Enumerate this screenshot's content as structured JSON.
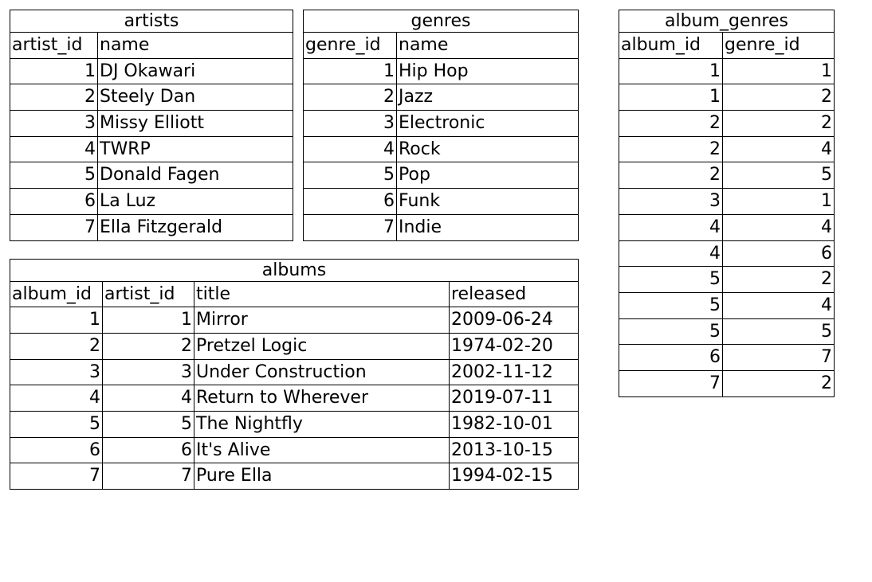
{
  "tables": {
    "artists": {
      "title": "artists",
      "columns": [
        "artist_id",
        "name"
      ],
      "col_types": [
        "num",
        "txt"
      ],
      "rows": [
        [
          1,
          "DJ Okawari"
        ],
        [
          2,
          "Steely Dan"
        ],
        [
          3,
          "Missy Elliott"
        ],
        [
          4,
          "TWRP"
        ],
        [
          5,
          "Donald Fagen"
        ],
        [
          6,
          "La Luz"
        ],
        [
          7,
          "Ella Fitzgerald"
        ]
      ]
    },
    "genres": {
      "title": "genres",
      "columns": [
        "genre_id",
        "name"
      ],
      "col_types": [
        "num",
        "txt"
      ],
      "rows": [
        [
          1,
          "Hip Hop"
        ],
        [
          2,
          "Jazz"
        ],
        [
          3,
          "Electronic"
        ],
        [
          4,
          "Rock"
        ],
        [
          5,
          "Pop"
        ],
        [
          6,
          "Funk"
        ],
        [
          7,
          "Indie"
        ]
      ]
    },
    "albums": {
      "title": "albums",
      "columns": [
        "album_id",
        "artist_id",
        "title",
        "released"
      ],
      "col_types": [
        "num",
        "num",
        "txt",
        "txt"
      ],
      "rows": [
        [
          1,
          1,
          "Mirror",
          "2009-06-24"
        ],
        [
          2,
          2,
          "Pretzel Logic",
          "1974-02-20"
        ],
        [
          3,
          3,
          "Under Construction",
          "2002-11-12"
        ],
        [
          4,
          4,
          "Return to Wherever",
          "2019-07-11"
        ],
        [
          5,
          5,
          "The Nightfly",
          "1982-10-01"
        ],
        [
          6,
          6,
          "It's Alive",
          "2013-10-15"
        ],
        [
          7,
          7,
          "Pure Ella",
          "1994-02-15"
        ]
      ]
    },
    "album_genres": {
      "title": "album_genres",
      "columns": [
        "album_id",
        "genre_id"
      ],
      "col_types": [
        "num",
        "num"
      ],
      "rows": [
        [
          1,
          1
        ],
        [
          1,
          2
        ],
        [
          2,
          2
        ],
        [
          2,
          4
        ],
        [
          2,
          5
        ],
        [
          3,
          1
        ],
        [
          4,
          4
        ],
        [
          4,
          6
        ],
        [
          5,
          2
        ],
        [
          5,
          4
        ],
        [
          5,
          5
        ],
        [
          6,
          7
        ],
        [
          7,
          2
        ]
      ]
    }
  }
}
